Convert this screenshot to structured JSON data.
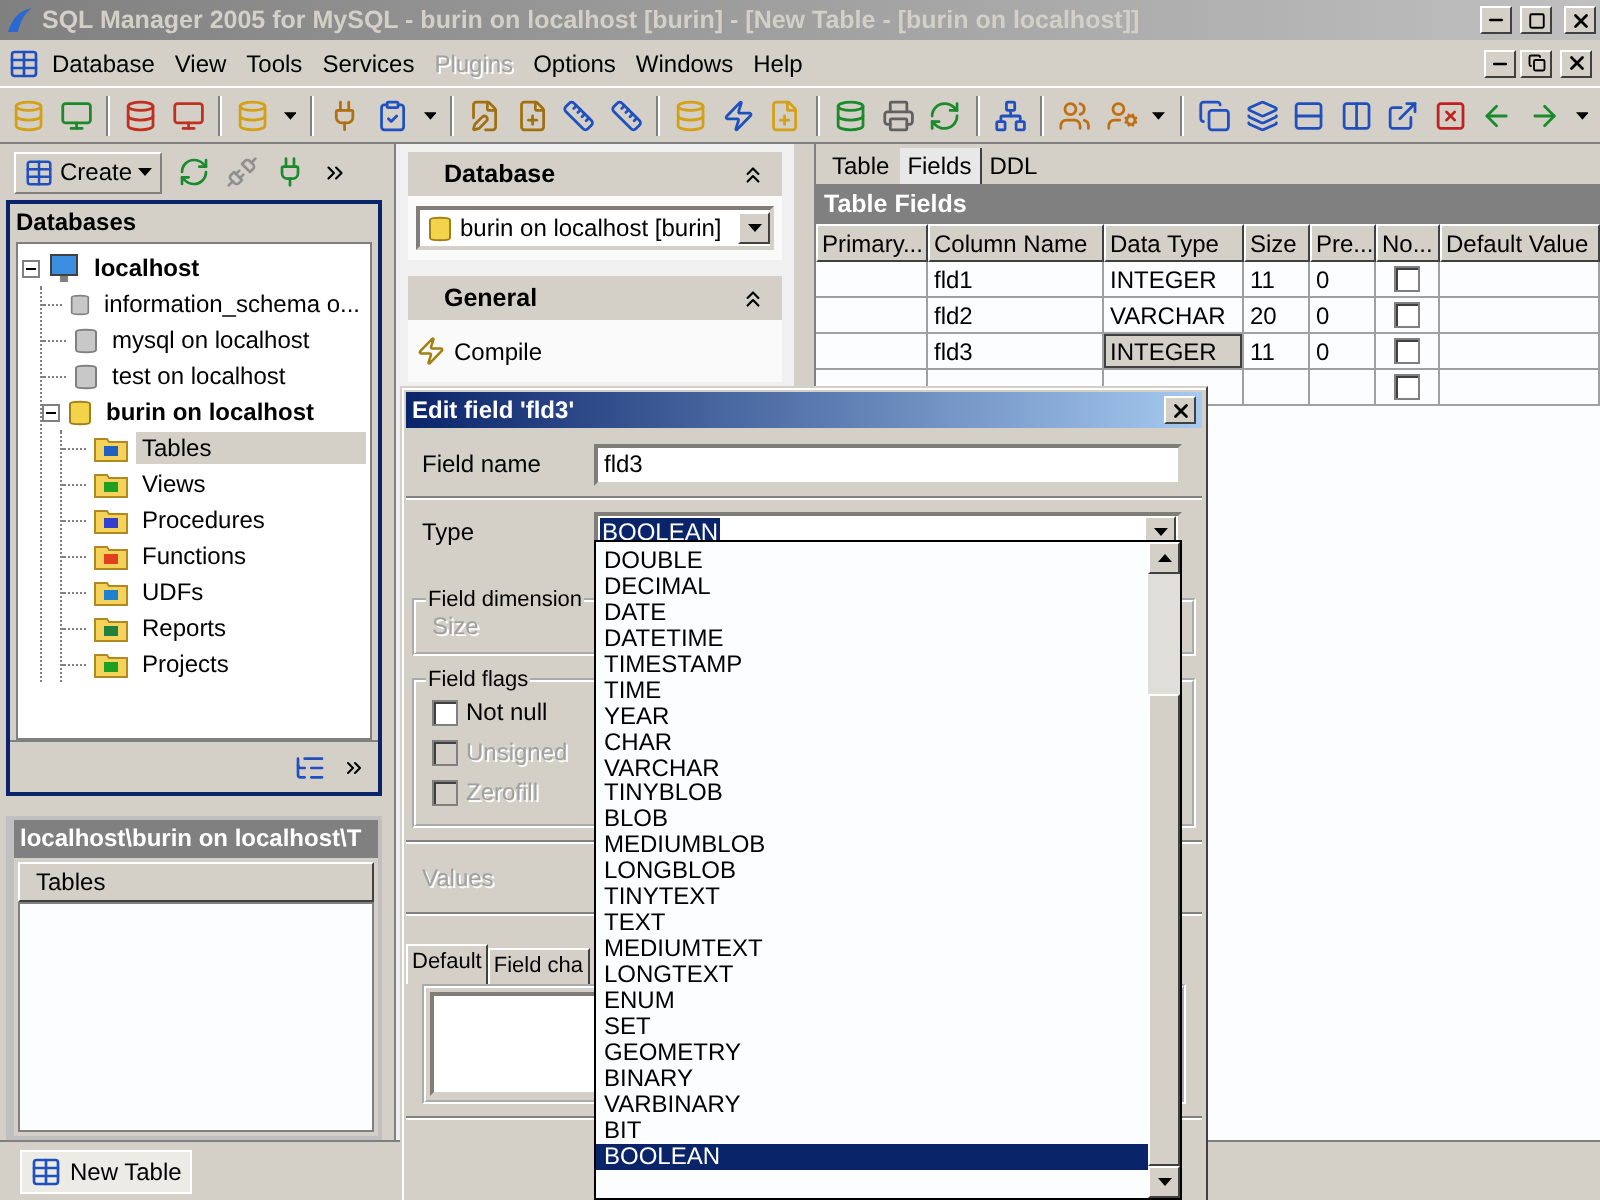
{
  "window": {
    "title": "SQL Manager 2005 for MySQL - burin on localhost [burin] - [New Table - [burin on localhost]]"
  },
  "menu": [
    {
      "label": "Database",
      "disabled": false
    },
    {
      "label": "View",
      "disabled": false
    },
    {
      "label": "Tools",
      "disabled": false
    },
    {
      "label": "Services",
      "disabled": false
    },
    {
      "label": "Plugins",
      "disabled": true
    },
    {
      "label": "Options",
      "disabled": false
    },
    {
      "label": "Windows",
      "disabled": false
    },
    {
      "label": "Help",
      "disabled": false
    }
  ],
  "left_panel": {
    "create_button": "Create",
    "title": "Databases",
    "tree": [
      {
        "label": "localhost",
        "kind": "host",
        "connected": true,
        "expanded": true,
        "selected": false,
        "children": [
          {
            "label": "information_schema o...",
            "kind": "database",
            "connected": false,
            "selected": false
          },
          {
            "label": "mysql on localhost",
            "kind": "database",
            "connected": false,
            "selected": false
          },
          {
            "label": "test on localhost",
            "kind": "database",
            "connected": false,
            "selected": false
          },
          {
            "label": "burin on localhost",
            "kind": "database",
            "connected": true,
            "expanded": true,
            "selected": false,
            "children": [
              {
                "label": "Tables",
                "kind": "tables",
                "selected": true
              },
              {
                "label": "Views",
                "kind": "views",
                "selected": false
              },
              {
                "label": "Procedures",
                "kind": "procedures",
                "selected": false
              },
              {
                "label": "Functions",
                "kind": "functions",
                "selected": false
              },
              {
                "label": "UDFs",
                "kind": "udfs",
                "selected": false
              },
              {
                "label": "Reports",
                "kind": "reports",
                "selected": false
              },
              {
                "label": "Projects",
                "kind": "projects",
                "selected": false
              }
            ]
          }
        ]
      }
    ]
  },
  "explorer": {
    "path": "localhost\\burin on localhost\\T",
    "column": "Tables"
  },
  "navigation": {
    "sections": [
      {
        "title": "Database",
        "database": "burin on localhost [burin]"
      },
      {
        "title": "General",
        "items": [
          "Compile"
        ]
      }
    ]
  },
  "editor": {
    "tabs": [
      {
        "label": "Table",
        "selected": false
      },
      {
        "label": "Fields",
        "selected": true
      },
      {
        "label": "DDL",
        "selected": false
      }
    ],
    "title": "Table Fields",
    "columns": [
      "Primary...",
      "Column Name",
      "Data Type",
      "Size",
      "Pre...",
      "No...",
      "Default Value"
    ],
    "rows": [
      {
        "name": "fld1",
        "type": "INTEGER",
        "size": "11",
        "precision": "0",
        "not_null": false,
        "editing": false
      },
      {
        "name": "fld2",
        "type": "VARCHAR",
        "size": "20",
        "precision": "0",
        "not_null": false,
        "editing": false
      },
      {
        "name": "fld3",
        "type": "INTEGER",
        "size": "11",
        "precision": "0",
        "not_null": false,
        "editing": true
      },
      {
        "not_null": false,
        "editing": false
      }
    ]
  },
  "dialog": {
    "title": "Edit field 'fld3'",
    "field_name": {
      "label": "Field name",
      "value": "fld3"
    },
    "type": {
      "label": "Type",
      "value": "BOOLEAN"
    },
    "dimension": {
      "title": "Field dimension",
      "size_label": "Size"
    },
    "flags": {
      "title": "Field flags",
      "items": [
        {
          "label": "Not null",
          "checked": false,
          "disabled": false
        },
        {
          "label": "Unsigned",
          "checked": false,
          "disabled": true
        },
        {
          "label": "Zerofill",
          "checked": false,
          "disabled": true
        }
      ]
    },
    "values": {
      "label": "Values"
    },
    "tabs": [
      {
        "label": "Default",
        "selected": true
      },
      {
        "label": "Field cha",
        "selected": false
      }
    ]
  },
  "type_list": [
    {
      "label": "DOUBLE",
      "selected": false
    },
    {
      "label": "DECIMAL",
      "selected": false
    },
    {
      "label": "DATE",
      "selected": false
    },
    {
      "label": "DATETIME",
      "selected": false
    },
    {
      "label": "TIMESTAMP",
      "selected": false
    },
    {
      "label": "TIME",
      "selected": false
    },
    {
      "label": "YEAR",
      "selected": false
    },
    {
      "label": "CHAR",
      "selected": false
    },
    {
      "label": "VARCHAR",
      "selected": false
    },
    {
      "label": "TINYBLOB",
      "selected": false
    },
    {
      "label": "BLOB",
      "selected": false
    },
    {
      "label": "MEDIUMBLOB",
      "selected": false
    },
    {
      "label": "LONGBLOB",
      "selected": false
    },
    {
      "label": "TINYTEXT",
      "selected": false
    },
    {
      "label": "TEXT",
      "selected": false
    },
    {
      "label": "MEDIUMTEXT",
      "selected": false
    },
    {
      "label": "LONGTEXT",
      "selected": false
    },
    {
      "label": "ENUM",
      "selected": false
    },
    {
      "label": "SET",
      "selected": false
    },
    {
      "label": "GEOMETRY",
      "selected": false
    },
    {
      "label": "BINARY",
      "selected": false
    },
    {
      "label": "VARBINARY",
      "selected": false
    },
    {
      "label": "BIT",
      "selected": false
    },
    {
      "label": "BOOLEAN",
      "selected": true
    }
  ],
  "taskbar": [
    {
      "label": "New Table",
      "selected": true
    }
  ]
}
